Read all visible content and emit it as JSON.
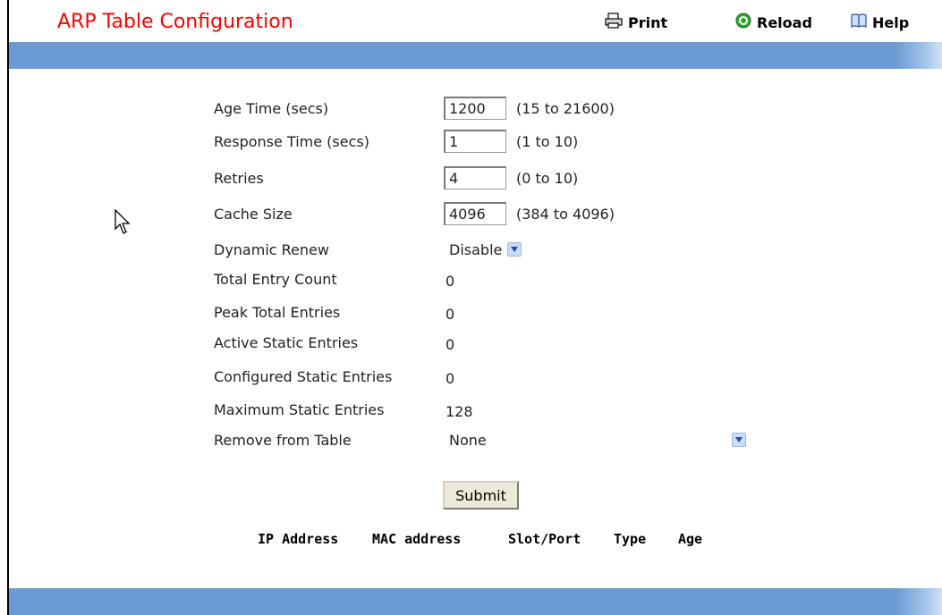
{
  "header": {
    "title": "ARP Table Configuration",
    "print_label": "Print",
    "reload_label": "Reload",
    "help_label": "Help"
  },
  "form": {
    "age_time": {
      "label": "Age Time (secs)",
      "value": "1200",
      "range": "(15 to 21600)"
    },
    "response_time": {
      "label": "Response Time (secs)",
      "value": "1",
      "range": "(1 to 10)"
    },
    "retries": {
      "label": "Retries",
      "value": "4",
      "range": "(0 to 10)"
    },
    "cache_size": {
      "label": "Cache Size",
      "value": "4096",
      "range": "(384 to 4096)"
    },
    "dynamic_renew": {
      "label": "Dynamic Renew",
      "value": "Disable"
    },
    "total_entry_count": {
      "label": "Total Entry Count",
      "value": "0"
    },
    "peak_total_entries": {
      "label": "Peak Total Entries",
      "value": "0"
    },
    "active_static_entries": {
      "label": "Active Static Entries",
      "value": "0"
    },
    "configured_static_entries": {
      "label": "Configured Static Entries",
      "value": "0"
    },
    "maximum_static_entries": {
      "label": "Maximum Static Entries",
      "value": "128"
    },
    "remove_from_table": {
      "label": "Remove from Table",
      "value": "None"
    },
    "submit_label": "Submit"
  },
  "table": {
    "columns": [
      "IP Address",
      "MAC address",
      "Slot/Port",
      "Type",
      "Age"
    ]
  },
  "colors": {
    "title": "#ff0000",
    "bar": "#6b9bd2"
  }
}
